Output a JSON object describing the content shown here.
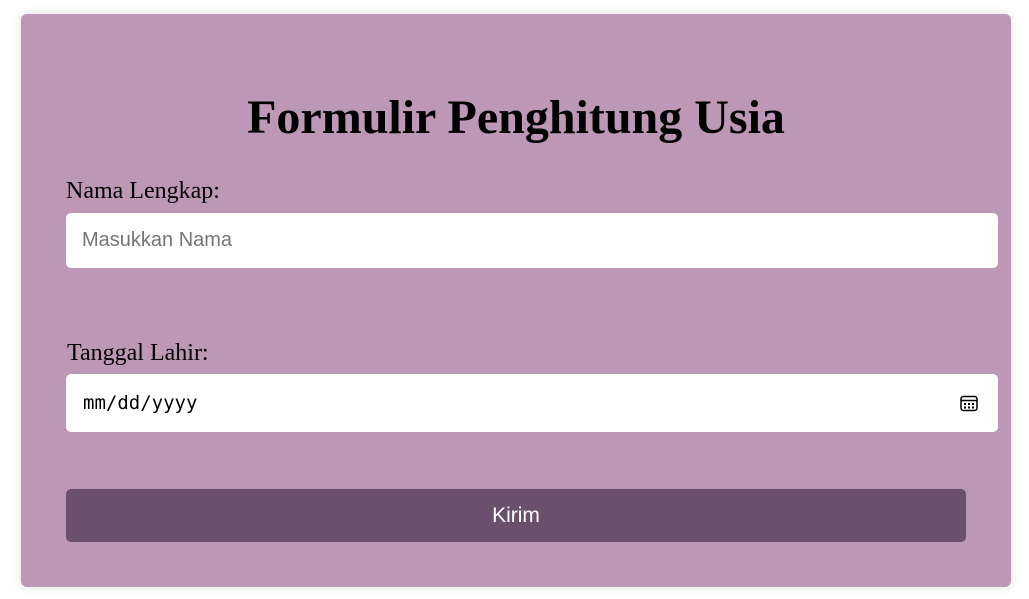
{
  "form": {
    "title": "Formulir Penghitung Usia",
    "name_label": "Nama Lengkap:",
    "name_placeholder": "Masukkan Nama",
    "name_value": "",
    "dob_label": "Tanggal Lahir:",
    "dob_placeholder": "mm/dd/yyyy",
    "submit_label": "Kirim"
  },
  "icons": {
    "calendar": "calendar-icon"
  },
  "colors": {
    "card_background": "#bc97b6",
    "button_background": "#6b506d",
    "button_text": "#ffffff",
    "field_background": "#ffffff"
  }
}
